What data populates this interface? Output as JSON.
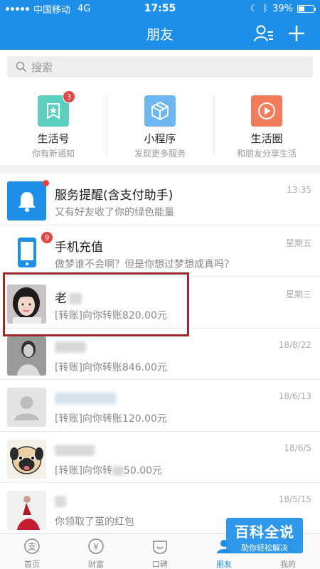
{
  "status_bar": {
    "carrier": "中国移动",
    "network": "4G",
    "time": "17:55",
    "battery": "39%"
  },
  "header": {
    "title": "朋友"
  },
  "search": {
    "placeholder": "搜索"
  },
  "shortcuts": [
    {
      "name": "生活号",
      "subtitle": "你有新通知",
      "badge": "3",
      "icon": "life-account-icon",
      "color": "#5ccfc1"
    },
    {
      "name": "小程序",
      "subtitle": "发现更多服务",
      "icon": "mini-program-icon",
      "color": "#6cb6f2"
    },
    {
      "name": "生活圈",
      "subtitle": "和朋友分享生活",
      "icon": "life-circle-icon",
      "color": "#f27c5b"
    }
  ],
  "messages": [
    {
      "name": "服务提醒(含支付助手)",
      "preview": "又有好友收了你的绿色能量",
      "time": "13:35",
      "unread_dot": true,
      "icon": "bell-icon"
    },
    {
      "name": "手机充值",
      "preview": "做梦谁不会啊？但是你想过梦想成真吗？",
      "time": "星期五",
      "badge": "9",
      "icon": "phone-icon"
    },
    {
      "name": "老",
      "preview": "[转账]向你转账820.00元",
      "time": "星期三",
      "avatar": "girl-photo"
    },
    {
      "name": "",
      "preview": "[转账]向你转账846.00元",
      "time": "18/8/22",
      "avatar": "bw-photo"
    },
    {
      "name": "",
      "preview": "[转账]向你转账120.00元",
      "time": "18/6/13",
      "avatar": "default-avatar"
    },
    {
      "name": "",
      "preview": "[转账]向你转",
      "preview_tail": "50.00元",
      "time": "18/6/5",
      "avatar": "pug-avatar"
    },
    {
      "name": "",
      "preview": "你领取了茧的红包",
      "time": "18/5/15",
      "avatar": "red-dress-photo"
    }
  ],
  "tabs": [
    {
      "label": "首页",
      "icon": "home-icon"
    },
    {
      "label": "财富",
      "icon": "wealth-icon"
    },
    {
      "label": "口碑",
      "icon": "koubei-icon"
    },
    {
      "label": "朋友",
      "icon": "friends-icon",
      "active": true
    },
    {
      "label": "我的",
      "icon": "me-icon"
    }
  ],
  "watermark": {
    "title": "百科全说",
    "subtitle": "助你轻松解决"
  },
  "colors": {
    "brand": "#1d8fe8",
    "badge": "#e64340",
    "highlight": "#a0282a"
  }
}
